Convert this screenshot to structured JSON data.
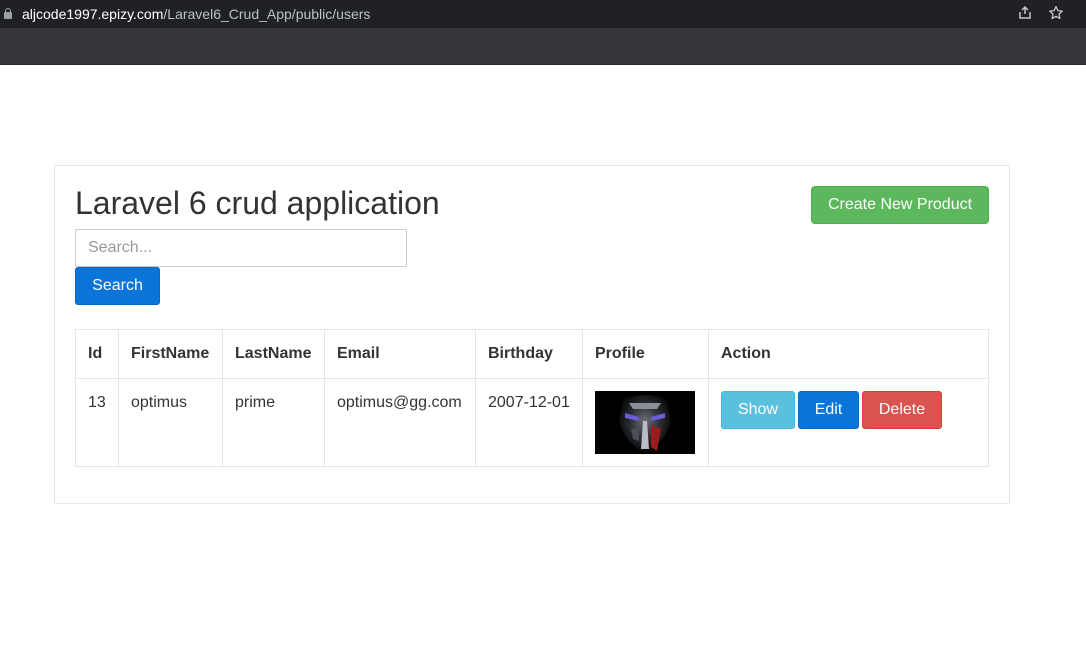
{
  "browser": {
    "url_host": "aljcode1997.epizy.com",
    "url_path": "/Laravel6_Crud_App/public/users",
    "icons": [
      "lock-icon",
      "share-icon",
      "star-icon"
    ]
  },
  "page": {
    "title": "Laravel 6 crud application",
    "create_button": "Create New Product",
    "search": {
      "placeholder": "Search...",
      "value": "",
      "button": "Search"
    }
  },
  "table": {
    "headers": [
      "Id",
      "FirstName",
      "LastName",
      "Email",
      "Birthday",
      "Profile",
      "Action"
    ],
    "rows": [
      {
        "id": "13",
        "first_name": "optimus",
        "last_name": "prime",
        "email": "optimus@gg.com",
        "birthday": "2007-12-01",
        "profile": "optimus-prime-portrait",
        "actions": {
          "show": "Show",
          "edit": "Edit",
          "delete": "Delete"
        }
      }
    ]
  },
  "colors": {
    "success": "#5cb85c",
    "primary": "#0a74d9",
    "info": "#5bc0de",
    "danger": "#d9534f"
  }
}
